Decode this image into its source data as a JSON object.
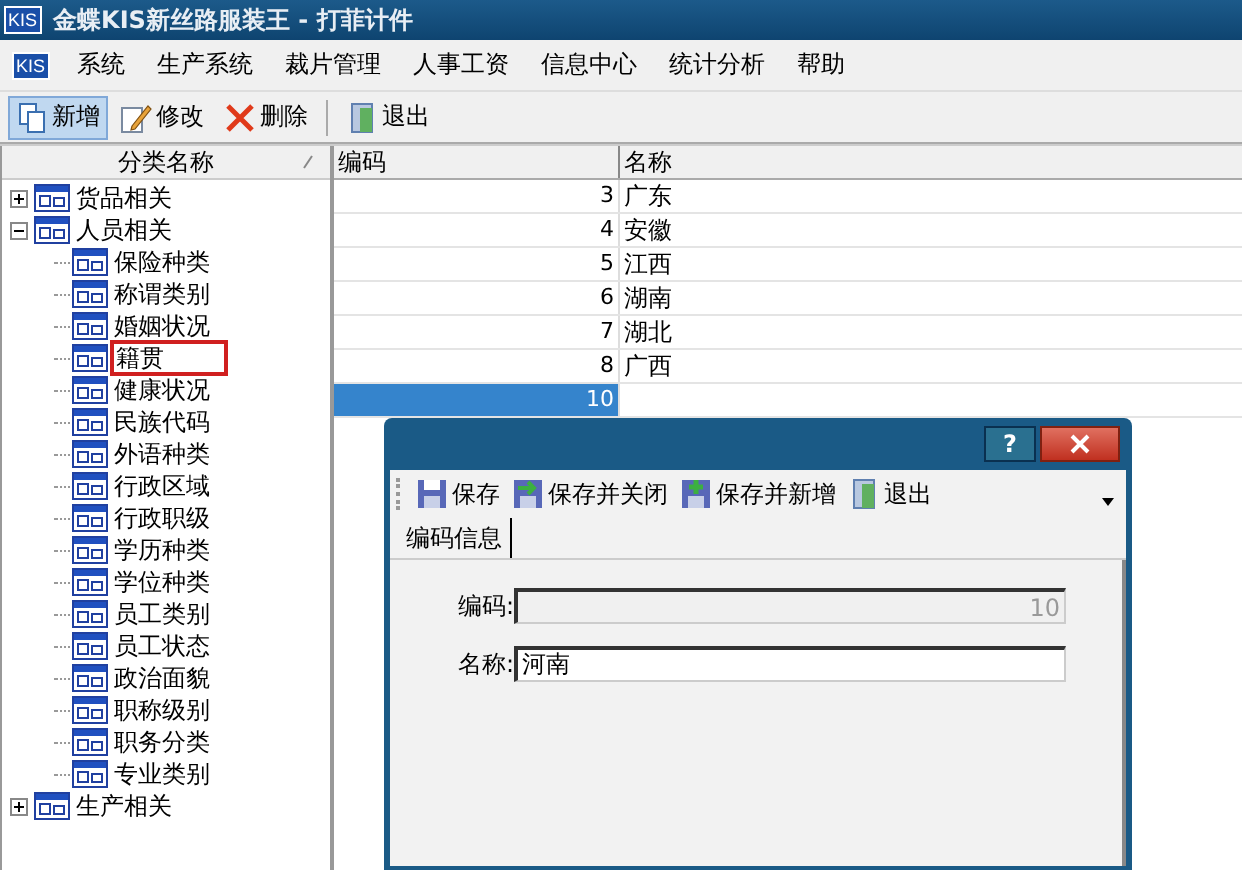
{
  "window": {
    "logo": "KIS",
    "title": "金蝶KIS新丝路服装王 - 打菲计件"
  },
  "menu": {
    "logo": "KIS",
    "items": [
      "系统",
      "生产系统",
      "裁片管理",
      "人事工资",
      "信息中心",
      "统计分析",
      "帮助"
    ]
  },
  "toolbar": [
    {
      "label": "新增",
      "kind": "new",
      "pressed": true
    },
    {
      "label": "修改",
      "kind": "edit",
      "pressed": false
    },
    {
      "label": "删除",
      "kind": "delete",
      "pressed": false
    },
    {
      "label": "退出",
      "kind": "exit",
      "pressed": false
    }
  ],
  "tree": {
    "header": "分类名称",
    "items": [
      {
        "label": "货品相关",
        "expanded": false,
        "selected": false
      },
      {
        "label": "人员相关",
        "expanded": true,
        "selected": false,
        "children": [
          {
            "label": "保险种类",
            "selected": false
          },
          {
            "label": "称谓类别",
            "selected": false
          },
          {
            "label": "婚姻状况",
            "selected": false
          },
          {
            "label": "籍贯",
            "selected": true
          },
          {
            "label": "健康状况",
            "selected": false
          },
          {
            "label": "民族代码",
            "selected": false
          },
          {
            "label": "外语种类",
            "selected": false
          },
          {
            "label": "行政区域",
            "selected": false
          },
          {
            "label": "行政职级",
            "selected": false
          },
          {
            "label": "学历种类",
            "selected": false
          },
          {
            "label": "学位种类",
            "selected": false
          },
          {
            "label": "员工类别",
            "selected": false
          },
          {
            "label": "员工状态",
            "selected": false
          },
          {
            "label": "政治面貌",
            "selected": false
          },
          {
            "label": "职称级别",
            "selected": false
          },
          {
            "label": "职务分类",
            "selected": false
          },
          {
            "label": "专业类别",
            "selected": false
          }
        ]
      },
      {
        "label": "生产相关",
        "expanded": false,
        "selected": false
      }
    ]
  },
  "table": {
    "columns": [
      "编码",
      "名称"
    ],
    "rows": [
      {
        "code": "3",
        "name": "广东",
        "selected": false
      },
      {
        "code": "4",
        "name": "安徽",
        "selected": false
      },
      {
        "code": "5",
        "name": "江西",
        "selected": false
      },
      {
        "code": "6",
        "name": "湖南",
        "selected": false
      },
      {
        "code": "7",
        "name": "湖北",
        "selected": false
      },
      {
        "code": "8",
        "name": "广西",
        "selected": false
      },
      {
        "code": "10",
        "selected": true
      }
    ]
  },
  "dialog": {
    "title_buttons": [
      "?"
    ],
    "toolbar": [
      {
        "label": "保存",
        "kind": "save"
      },
      {
        "label": "保存并关闭",
        "kind": "save-close"
      },
      {
        "label": "保存并新增",
        "kind": "save-new"
      },
      {
        "label": "退出",
        "kind": "exit"
      }
    ],
    "tabs": [
      {
        "label": "编码信息",
        "selected": true
      }
    ],
    "fields": [
      {
        "label": "编码:",
        "value": "10",
        "disabled": true
      },
      {
        "label": "名称:",
        "value": "河南",
        "disabled": false
      }
    ]
  }
}
